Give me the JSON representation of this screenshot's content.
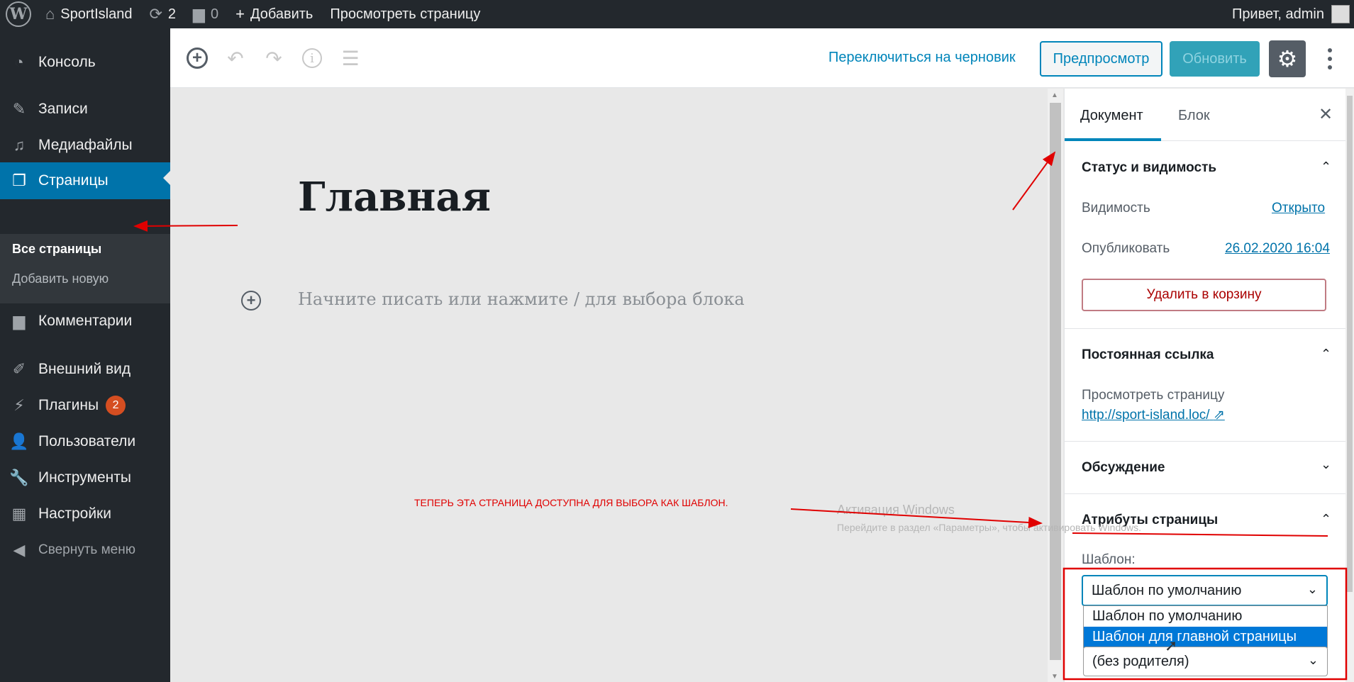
{
  "adminbar": {
    "site_name": "SportIsland",
    "updates_count": "2",
    "comments_count": "0",
    "add_label": "Добавить",
    "view_page_label": "Просмотреть страницу",
    "greeting": "Привет, admin"
  },
  "sidebar": {
    "items": [
      {
        "label": "Консоль",
        "icon": "dashboard-icon"
      },
      {
        "label": "Записи",
        "icon": "pin-icon"
      },
      {
        "label": "Медиафайлы",
        "icon": "media-icon"
      },
      {
        "label": "Страницы",
        "icon": "pages-icon"
      },
      {
        "label": "Комментарии",
        "icon": "comments-icon"
      },
      {
        "label": "Внешний вид",
        "icon": "appearance-icon"
      },
      {
        "label": "Плагины",
        "icon": "plugins-icon"
      },
      {
        "label": "Пользователи",
        "icon": "users-icon"
      },
      {
        "label": "Инструменты",
        "icon": "tools-icon"
      },
      {
        "label": "Настройки",
        "icon": "settings-icon"
      },
      {
        "label": "Свернуть меню",
        "icon": "collapse-icon"
      }
    ],
    "submenu": {
      "all_pages": "Все страницы",
      "add_new": "Добавить новую"
    },
    "plugins_badge": "2",
    "accent_color": "#0073aa"
  },
  "toolbar": {
    "switch_to_draft": "Переключиться на черновик",
    "preview": "Предпросмотр",
    "update": "Обновить"
  },
  "editor": {
    "title": "Главная",
    "placeholder": "Начните писать или нажмите / для выбора блока",
    "annotation": "ТЕПЕРЬ ЭТА СТРАНИЦА ДОСТУПНА ДЛЯ ВЫБОРА КАК ШАБЛОН."
  },
  "settings": {
    "tabs": {
      "document": "Документ",
      "block": "Блок"
    },
    "status": {
      "title": "Статус и видимость",
      "visibility_label": "Видимость",
      "visibility_value": "Открыто",
      "publish_label": "Опубликовать",
      "publish_value": "26.02.2020 16:04",
      "trash": "Удалить в корзину"
    },
    "permalink": {
      "title": "Постоянная ссылка",
      "view_label": "Просмотреть страницу",
      "url": "http://sport-island.loc/"
    },
    "discussion": {
      "title": "Обсуждение"
    },
    "page_attributes": {
      "title": "Атрибуты страницы",
      "template_label": "Шаблон:",
      "template_value": "Шаблон по умолчанию",
      "template_options": [
        "Шаблон по умолчанию",
        "Шаблон для главной страницы"
      ],
      "selected_option": "Шаблон для главной страницы",
      "parent_value": "(без родителя)"
    }
  },
  "watermark": {
    "line1": "Активация Windows",
    "line2": "Перейдите в раздел «Параметры», чтобы активировать Windows."
  }
}
